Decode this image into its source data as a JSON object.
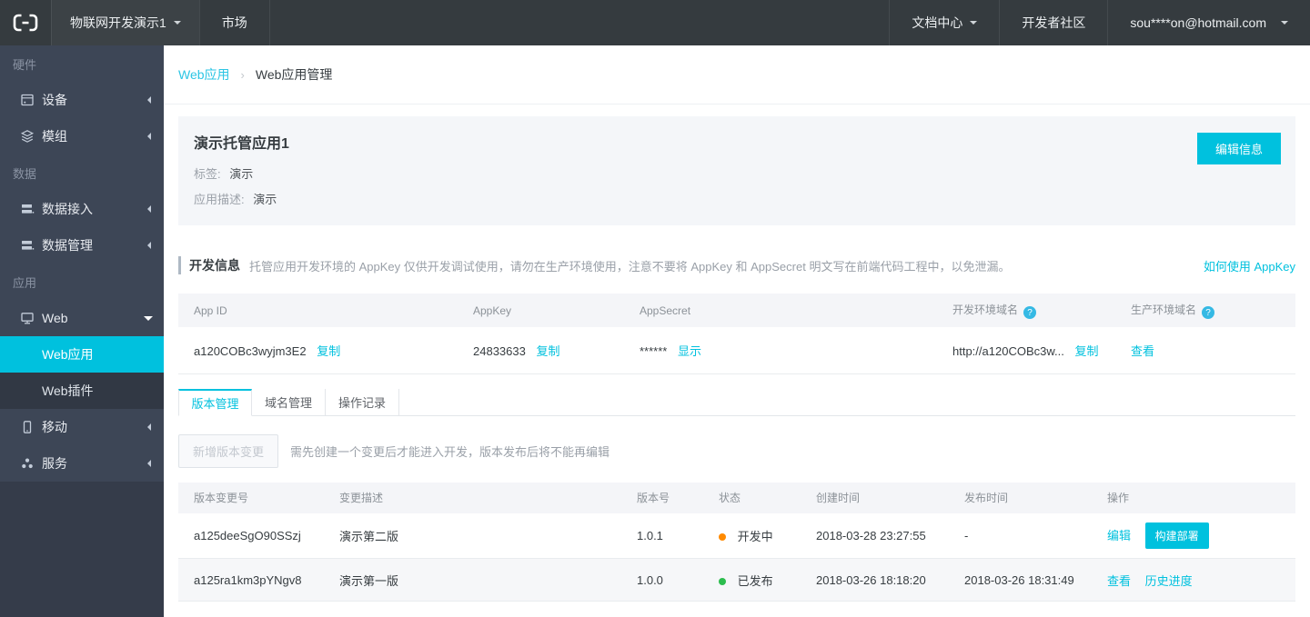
{
  "colors": {
    "accent": "#00c1de",
    "status_dev": "#ff8a00",
    "status_published": "#2cbd4e"
  },
  "icons": {
    "help": "?"
  },
  "topbar": {
    "project_menu": "物联网开发演示1",
    "market": "市场",
    "docs": "文档中心",
    "community": "开发者社区",
    "account": "sou****on@hotmail.com"
  },
  "sidebar": {
    "groups": [
      {
        "label": "硬件",
        "items": [
          {
            "label": "设备"
          },
          {
            "label": "模组"
          }
        ]
      },
      {
        "label": "数据",
        "items": [
          {
            "label": "数据接入"
          },
          {
            "label": "数据管理"
          }
        ]
      },
      {
        "label": "应用",
        "items": [
          {
            "label": "Web"
          },
          {
            "label": "移动"
          },
          {
            "label": "服务"
          }
        ]
      }
    ],
    "web_children": [
      {
        "label": "Web应用"
      },
      {
        "label": "Web插件"
      }
    ]
  },
  "breadcrumb": {
    "parent": "Web应用",
    "separator": "›",
    "current": "Web应用管理"
  },
  "app_card": {
    "title": "演示托管应用1",
    "tag_label": "标签:",
    "tag_value": "演示",
    "desc_label": "应用描述:",
    "desc_value": "演示",
    "edit_button": "编辑信息"
  },
  "dev_info": {
    "title": "开发信息",
    "description": "托管应用开发环境的 AppKey 仅供开发调试使用，请勿在生产环境使用，注意不要将 AppKey 和 AppSecret 明文写在前端代码工程中，以免泄漏。",
    "help_link": "如何使用 AppKey",
    "table": {
      "headers": [
        "App ID",
        "AppKey",
        "AppSecret",
        "开发环境域名",
        "生产环境域名"
      ],
      "row": {
        "app_id": "a120COBc3wyjm3E2",
        "app_id_copy": "复制",
        "app_key": "24833633",
        "app_key_copy": "复制",
        "app_secret": "******",
        "app_secret_show": "显示",
        "dev_domain": "http://a120COBc3w...",
        "dev_domain_copy": "复制",
        "prod_domain_view": "查看"
      }
    }
  },
  "tabs": [
    {
      "label": "版本管理"
    },
    {
      "label": "域名管理"
    },
    {
      "label": "操作记录"
    }
  ],
  "version_section": {
    "add_button": "新增版本变更",
    "hint": "需先创建一个变更后才能进入开发，版本发布后将不能再编辑",
    "table": {
      "headers": [
        "版本变更号",
        "变更描述",
        "版本号",
        "状态",
        "创建时间",
        "发布时间",
        "操作"
      ],
      "rows": [
        {
          "change_id": "a125deeSgO90SSzj",
          "desc": "演示第二版",
          "version": "1.0.1",
          "status": "开发中",
          "status_color": "#ff8a00",
          "created": "2018-03-28 23:27:55",
          "published": "-",
          "action_edit": "编辑",
          "action_deploy": "构建部署"
        },
        {
          "change_id": "a125ra1km3pYNgv8",
          "desc": "演示第一版",
          "version": "1.0.0",
          "status": "已发布",
          "status_color": "#2cbd4e",
          "created": "2018-03-26 18:18:20",
          "published": "2018-03-26 18:31:49",
          "action_view": "查看",
          "action_history": "历史进度"
        }
      ]
    }
  }
}
